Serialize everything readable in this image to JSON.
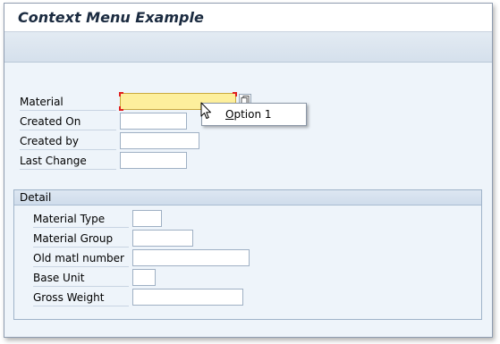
{
  "window": {
    "title": "Context Menu Example"
  },
  "header_fields": [
    {
      "label": "Material",
      "value": "",
      "focused": true
    },
    {
      "label": "Created On",
      "value": ""
    },
    {
      "label": "Created by",
      "value": ""
    },
    {
      "label": "Last Change",
      "value": ""
    }
  ],
  "detail": {
    "title": "Detail",
    "fields": [
      {
        "label": "Material Type",
        "value": ""
      },
      {
        "label": "Material Group",
        "value": ""
      },
      {
        "label": "Old matl number",
        "value": ""
      },
      {
        "label": "Base Unit",
        "value": ""
      },
      {
        "label": "Gross Weight",
        "value": ""
      }
    ]
  },
  "context_menu": {
    "items": [
      {
        "mnemonic": "O",
        "rest": "ption 1"
      }
    ]
  },
  "icons": {
    "value_help": "value-help-icon",
    "pointer": "mouse-pointer-icon"
  },
  "colors": {
    "focus_field": "#fdef9c",
    "focus_corners": "#e02020",
    "background": "#eef4fa"
  }
}
